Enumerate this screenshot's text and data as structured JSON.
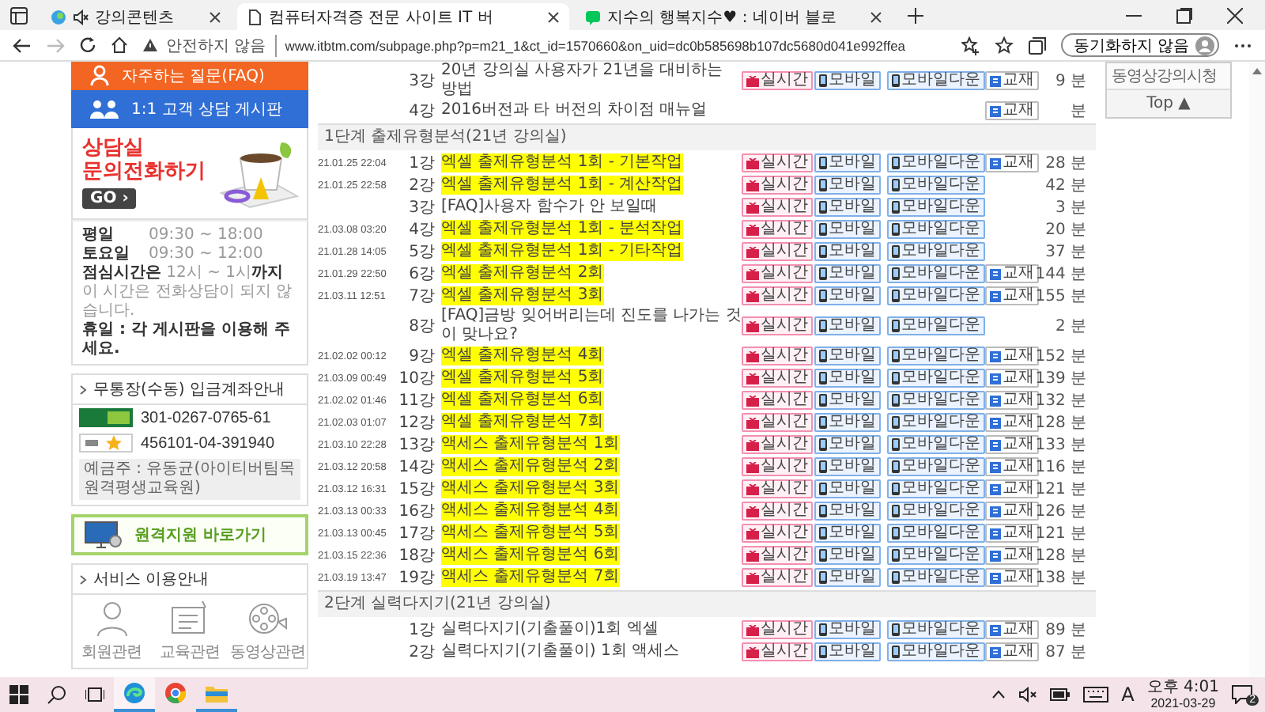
{
  "browser": {
    "tabs": [
      {
        "title": "강의콘텐츠",
        "selected": false,
        "muted": true
      },
      {
        "title": "컴퓨터자격증 전문 사이트 IT 버",
        "selected": true,
        "muted": false
      },
      {
        "title": "지수의 행복지수♥ : 네이버 블로",
        "selected": false,
        "muted": false
      }
    ],
    "address_bar": {
      "security": "안전하지 않음",
      "url": "www.itbtm.com/subpage.php?p=m21_1&ct_id=1570660&on_uid=dc0b585698b107dc5680d041e992ffea"
    },
    "profile_button": "동기화하지 않음"
  },
  "sidebar": {
    "faq": "자주하는 질문(FAQ)",
    "qna": "1:1 고객 상담 게시판",
    "call_banner": {
      "title": "상담실",
      "subtitle": "문의전화하기",
      "button": "GO ›"
    },
    "hours": [
      {
        "label": "평일",
        "time": "09:30 ~ 18:00"
      },
      {
        "label": "토요일",
        "time": "09:30 ~ 12:00"
      }
    ],
    "lunch": "**점심시간은** 12시 ~ 1시**까지**",
    "lunch_note": "이 시간은 전화상담이 되지 않습니다.",
    "holiday": "휴일 : 각 게시판을 이용해 주세요.",
    "bank": {
      "title": "무통장(수동) 입금계좌안내",
      "accounts": [
        {
          "kind": "nonghyup",
          "number": "301-0267-0765-61"
        },
        {
          "kind": "kb",
          "number": "456101-04-391940"
        }
      ],
      "holder": "예금주 : 유동균(아이티버팀목 원격평생교육원)"
    },
    "remote_support": "원격지원 바로가기",
    "services": {
      "title": "서비스 이용안내",
      "items": [
        {
          "kind": "member",
          "label": "회원관련"
        },
        {
          "kind": "education",
          "label": "교육관련"
        },
        {
          "kind": "video",
          "label": "동영상관련"
        }
      ]
    }
  },
  "lectures": {
    "sections": [
      {
        "rows": [
          {
            "number": "3강",
            "title": "20년 강의실 사용자가 21년을 대비하는 방법",
            "highlighted": false,
            "live": "실시간",
            "mobile": "모바일",
            "mobile_download": "모바일다운",
            "textbook": "교재",
            "duration": "9 분"
          },
          {
            "number": "4강",
            "title": "2016버전과 타 버전의 차이점 매뉴얼",
            "highlighted": false,
            "textbook": "교재",
            "duration": "분"
          }
        ]
      },
      {
        "title": "1단계 출제유형분석(21년 강의실)",
        "rows": [
          {
            "date": "21.01.25 22:04",
            "number": "1강",
            "title": "엑셀 출제유형분석 1회 - 기본작업",
            "highlighted": true,
            "live": "실시간",
            "mobile": "모바일",
            "mobile_download": "모바일다운",
            "textbook": "교재",
            "duration": "28 분"
          },
          {
            "date": "21.01.25 22:58",
            "number": "2강",
            "title": "엑셀 출제유형분석 1회 - 계산작업",
            "highlighted": true,
            "live": "실시간",
            "mobile": "모바일",
            "mobile_download": "모바일다운",
            "duration": "42 분"
          },
          {
            "number": "3강",
            "title": "[FAQ]사용자 함수가 안 보일때",
            "highlighted": false,
            "live": "실시간",
            "mobile": "모바일",
            "mobile_download": "모바일다운",
            "duration": "3 분"
          },
          {
            "date": "21.03.08 03:20",
            "number": "4강",
            "title": "엑셀 출제유형분석 1회 - 분석작업",
            "highlighted": true,
            "live": "실시간",
            "mobile": "모바일",
            "mobile_download": "모바일다운",
            "duration": "20 분"
          },
          {
            "date": "21.01.28 14:05",
            "number": "5강",
            "title": "엑셀 출제유형분석 1회 - 기타작업",
            "highlighted": true,
            "live": "실시간",
            "mobile": "모바일",
            "mobile_download": "모바일다운",
            "duration": "37 분"
          },
          {
            "date": "21.01.29 22:50",
            "number": "6강",
            "title": "엑셀 출제유형분석 2회",
            "highlighted": true,
            "live": "실시간",
            "mobile": "모바일",
            "mobile_download": "모바일다운",
            "textbook": "교재",
            "duration": "144 분"
          },
          {
            "date": "21.03.11 12:51",
            "number": "7강",
            "title": "엑셀 출제유형분석 3회",
            "highlighted": true,
            "live": "실시간",
            "mobile": "모바일",
            "mobile_download": "모바일다운",
            "textbook": "교재",
            "duration": "155 분"
          },
          {
            "number": "8강",
            "title": "[FAQ]금방 잊어버리는데 진도를 나가는 것이 맞나요?",
            "highlighted": false,
            "live": "실시간",
            "mobile": "모바일",
            "mobile_download": "모바일다운",
            "duration": "2 분"
          },
          {
            "date": "21.02.02 00:12",
            "number": "9강",
            "title": "엑셀 출제유형분석 4회",
            "highlighted": true,
            "live": "실시간",
            "mobile": "모바일",
            "mobile_download": "모바일다운",
            "textbook": "교재",
            "duration": "152 분"
          },
          {
            "date": "21.03.09 00:49",
            "number": "10강",
            "title": "엑셀 출제유형분석 5회",
            "highlighted": true,
            "live": "실시간",
            "mobile": "모바일",
            "mobile_download": "모바일다운",
            "textbook": "교재",
            "duration": "139 분"
          },
          {
            "date": "21.02.02 01:46",
            "number": "11강",
            "title": "엑셀 출제유형분석 6회",
            "highlighted": true,
            "live": "실시간",
            "mobile": "모바일",
            "mobile_download": "모바일다운",
            "textbook": "교재",
            "duration": "132 분"
          },
          {
            "date": "21.02.03 01:07",
            "number": "12강",
            "title": "엑셀 출제유형분석 7회",
            "highlighted": true,
            "live": "실시간",
            "mobile": "모바일",
            "mobile_download": "모바일다운",
            "textbook": "교재",
            "duration": "128 분"
          },
          {
            "date": "21.03.10 22:28",
            "number": "13강",
            "title": "액세스 출제유형분석 1회",
            "highlighted": true,
            "live": "실시간",
            "mobile": "모바일",
            "mobile_download": "모바일다운",
            "textbook": "교재",
            "duration": "133 분"
          },
          {
            "date": "21.03.12 20:58",
            "number": "14강",
            "title": "액세스 출제유형분석 2회",
            "highlighted": true,
            "live": "실시간",
            "mobile": "모바일",
            "mobile_download": "모바일다운",
            "textbook": "교재",
            "duration": "116 분"
          },
          {
            "date": "21.03.12 16:31",
            "number": "15강",
            "title": "액세스 출제유형분석 3회",
            "highlighted": true,
            "live": "실시간",
            "mobile": "모바일",
            "mobile_download": "모바일다운",
            "textbook": "교재",
            "duration": "121 분"
          },
          {
            "date": "21.03.13 00:33",
            "number": "16강",
            "title": "액세스 출제유형분석 4회",
            "highlighted": true,
            "live": "실시간",
            "mobile": "모바일",
            "mobile_download": "모바일다운",
            "textbook": "교재",
            "duration": "126 분"
          },
          {
            "date": "21.03.13 00:45",
            "number": "17강",
            "title": "액세스 출제유형분석 5회",
            "highlighted": true,
            "live": "실시간",
            "mobile": "모바일",
            "mobile_download": "모바일다운",
            "textbook": "교재",
            "duration": "121 분"
          },
          {
            "date": "21.03.15 22:36",
            "number": "18강",
            "title": "액세스 출제유형분석 6회",
            "highlighted": true,
            "live": "실시간",
            "mobile": "모바일",
            "mobile_download": "모바일다운",
            "textbook": "교재",
            "duration": "128 분"
          },
          {
            "date": "21.03.19 13:47",
            "number": "19강",
            "title": "액세스 출제유형분석 7회",
            "highlighted": true,
            "live": "실시간",
            "mobile": "모바일",
            "mobile_download": "모바일다운",
            "textbook": "교재",
            "duration": "138 분"
          }
        ]
      },
      {
        "title": "2단계 실력다지기(21년 강의실)",
        "rows": [
          {
            "number": "1강",
            "title": "실력다지기(기출풀이)1회 엑셀",
            "highlighted": false,
            "live": "실시간",
            "mobile": "모바일",
            "mobile_download": "모바일다운",
            "textbook": "교재",
            "duration": "89 분"
          },
          {
            "number": "2강",
            "title": "실력다지기(기출풀이) 1회 액세스",
            "highlighted": false,
            "live": "실시간",
            "mobile": "모바일",
            "mobile_download": "모바일다운",
            "textbook": "교재",
            "duration": "87 분"
          }
        ]
      }
    ]
  },
  "quick_menu": {
    "title": "동영상강의시청",
    "top_button": "Top ▲"
  },
  "taskbar": {
    "apps": [
      {
        "kind": "edge",
        "running": true,
        "selected": true
      },
      {
        "kind": "chrome",
        "running": false,
        "selected": false
      },
      {
        "kind": "files",
        "running": true,
        "selected": false
      }
    ],
    "ime": "A",
    "time": "오후 4:01",
    "date": "2021-03-29",
    "notifications": "2"
  }
}
